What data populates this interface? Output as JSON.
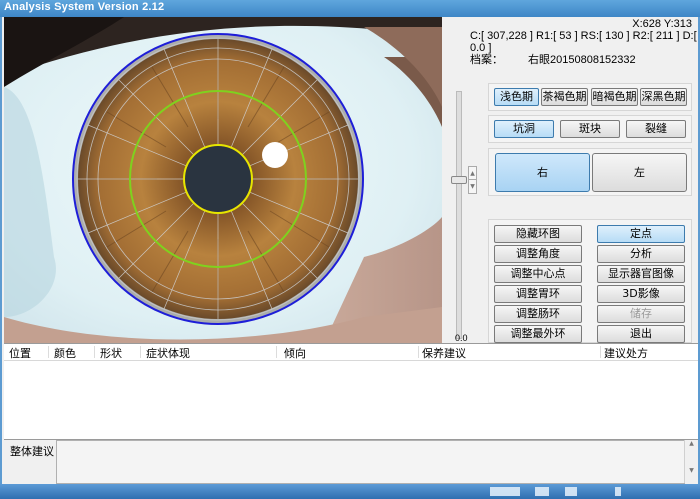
{
  "window": {
    "title": "Analysis System Version 2.12"
  },
  "readout": {
    "xy": "X:628 Y:313",
    "params": "C:[ 307,228 ] R1:[ 53 ] RS:[ 130 ] R2:[ 211 ] D:[ 0.0 ]",
    "archive_label": "档案：",
    "archive_value": "右眼20150808152332"
  },
  "slider": {
    "value_label": "0.0",
    "level": 0.35
  },
  "color_phase": {
    "options": [
      "浅色期",
      "茶褐色期",
      "暗褐色期",
      "深黑色期"
    ],
    "selected": 0
  },
  "marks": {
    "options": [
      "坑洞",
      "斑块",
      "裂缝"
    ],
    "selected": 0
  },
  "side": {
    "options": [
      "右",
      "左"
    ],
    "selected": 0
  },
  "actions": {
    "left": [
      "隐藏环图",
      "调整角度",
      "调整中心点",
      "调整胃环",
      "调整肠环",
      "调整最外环"
    ],
    "right": [
      "定点",
      "分析",
      "显示器官图像",
      "3D影像",
      "储存",
      "退出"
    ],
    "disabled": [
      "储存"
    ]
  },
  "table": {
    "columns": [
      "位置",
      "颜色",
      "形状",
      "症状体现",
      "倾向",
      "保养建议",
      "建议处方"
    ],
    "rows": []
  },
  "advice": {
    "label": "整体建议",
    "value": ""
  },
  "colors": {
    "title_bar": "#3e86c6",
    "outer_ring": "#2020d8",
    "middle_ring": "#7fd21e",
    "pupil_ring": "#e6e600",
    "iris": "#b2793a",
    "selected_button": "#b7dcf6"
  }
}
